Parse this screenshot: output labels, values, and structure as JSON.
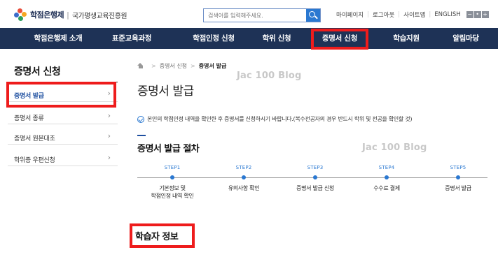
{
  "header": {
    "logo_name": "학점은행제",
    "logo_sep": "|",
    "logo_org": "국가평생교육진흥원",
    "search_placeholder": "검색어를 입력해주세요.",
    "utils": [
      "마이페이지",
      "로그아웃",
      "사이트맵",
      "ENGLISH"
    ],
    "font_buttons": [
      "−",
      "•",
      "+"
    ]
  },
  "nav": {
    "items": [
      "학점은행제 소개",
      "표준교육과정",
      "학점인정 신청",
      "학위 신청",
      "증명서 신청",
      "학습지원",
      "알림마당"
    ],
    "selected": "증명서 신청"
  },
  "sidebar": {
    "title": "증명서 신청",
    "items": [
      {
        "label": "증명서 발급",
        "active": true
      },
      {
        "label": "증명서 종류",
        "active": false
      },
      {
        "label": "증명서 원본대조",
        "active": false
      },
      {
        "label": "학위증 우편신청",
        "active": false
      }
    ],
    "arrow": "›"
  },
  "breadcrumb": {
    "items": [
      "증명서 신청",
      "증명서 발급"
    ],
    "sep": ">"
  },
  "watermarks": [
    "Jac 100 Blog",
    "Jac 100 Blog"
  ],
  "main": {
    "title": "증명서 발급",
    "notice": "본인의 학점인정 내역을 확인한 후 증명서를 신청하시기 바랍니다.(복수전공자의 경우 반드시 학위 및 전공을 확인할 것)",
    "process_title": "증명서 발급 절차",
    "steps": [
      {
        "num": "STEP1",
        "label": "기본정보 및\n학점인정 내역 확인"
      },
      {
        "num": "STEP2",
        "label": "유의사항 확인"
      },
      {
        "num": "STEP3",
        "label": "증명서 발급 신청"
      },
      {
        "num": "STEP4",
        "label": "수수료 결제"
      },
      {
        "num": "STEP5",
        "label": "증명서 발급"
      }
    ],
    "learner_title": "학습자 정보"
  },
  "colors": {
    "nav_bg": "#1e3256",
    "accent": "#2a78d1",
    "highlight": "#ee1c1c"
  }
}
